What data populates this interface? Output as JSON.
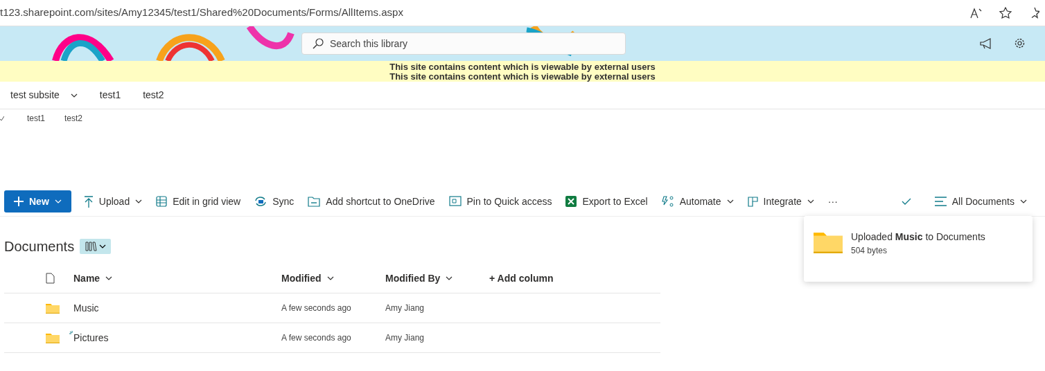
{
  "browser": {
    "url": "t123.sharepoint.com/sites/Amy12345/test1/Shared%20Documents/Forms/AllItems.aspx"
  },
  "header": {
    "search": {
      "placeholder": "Search this library"
    }
  },
  "banner": [
    "This site contains content which is viewable by external users",
    "This site contains content which is viewable by external users"
  ],
  "top_nav": [
    {
      "label": "test subsite",
      "dropdown": true
    },
    {
      "label": "test1",
      "dropdown": false
    },
    {
      "label": "test2",
      "dropdown": false
    }
  ],
  "sub_nav": [
    {
      "label": "test1"
    },
    {
      "label": "test2"
    }
  ],
  "command_bar": [
    {
      "kind": "new",
      "label": "New",
      "dropdown": true
    },
    {
      "kind": "upload",
      "label": "Upload",
      "dropdown": true
    },
    {
      "kind": "grid",
      "label": "Edit in grid view",
      "dropdown": false
    },
    {
      "kind": "sync",
      "label": "Sync",
      "dropdown": false
    },
    {
      "kind": "shortcut",
      "label": "Add shortcut to OneDrive",
      "dropdown": false
    },
    {
      "kind": "pin",
      "label": "Pin to Quick access",
      "dropdown": false
    },
    {
      "kind": "excel",
      "label": "Export to Excel",
      "dropdown": false
    },
    {
      "kind": "automate",
      "label": "Automate",
      "dropdown": true
    },
    {
      "kind": "integrate",
      "label": "Integrate",
      "dropdown": true
    },
    {
      "kind": "more",
      "label": "···",
      "dropdown": false
    }
  ],
  "view": {
    "label": "All Documents"
  },
  "library": {
    "title": "Documents"
  },
  "table": {
    "columns": [
      {
        "label": "Name",
        "sortable": true
      },
      {
        "label": "Modified",
        "sortable": true
      },
      {
        "label": "Modified By",
        "sortable": true
      }
    ],
    "add_column": "+ Add column",
    "rows": [
      {
        "name": "Music",
        "modified": "A few seconds ago",
        "modified_by": "Amy Jiang",
        "syncing": false
      },
      {
        "name": "Pictures",
        "modified": "A few seconds ago",
        "modified_by": "Amy Jiang",
        "syncing": true
      }
    ]
  },
  "toast": {
    "message": "Uploaded **Music** to Documents",
    "detail": "504 bytes"
  }
}
